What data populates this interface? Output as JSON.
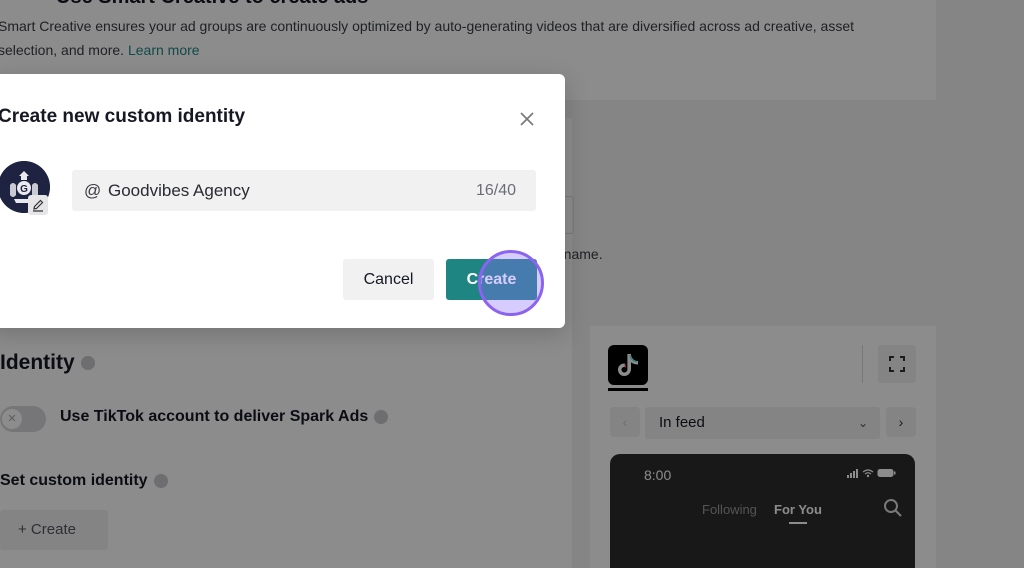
{
  "background": {
    "smart_creative_heading": "Use Smart Creative to create ads",
    "smart_creative_desc": "Smart Creative ensures your ad groups are continuously optimized by auto-generating videos that are diversified across ad creative, asset selection, and more.",
    "learn_more": "Learn more",
    "brand_name_hint_fragment": "d name.",
    "identity_title": "Identity",
    "spark_ads_label": "Use TikTok account to deliver Spark Ads",
    "custom_identity_label": "Set custom identity",
    "create_button": "+ Create"
  },
  "preview": {
    "placement": "In feed",
    "phone_time": "8:00",
    "tab_following": "Following",
    "tab_for_you": "For You"
  },
  "modal": {
    "title": "Create new custom identity",
    "at_symbol": "@",
    "display_name": "Goodvibes Agency",
    "char_counter": "16/40",
    "cancel_label": "Cancel",
    "create_label": "Create"
  },
  "colors": {
    "accent": "#1f8582",
    "click_indicator": "#8c63f0",
    "learn_more": "#1e8785"
  }
}
